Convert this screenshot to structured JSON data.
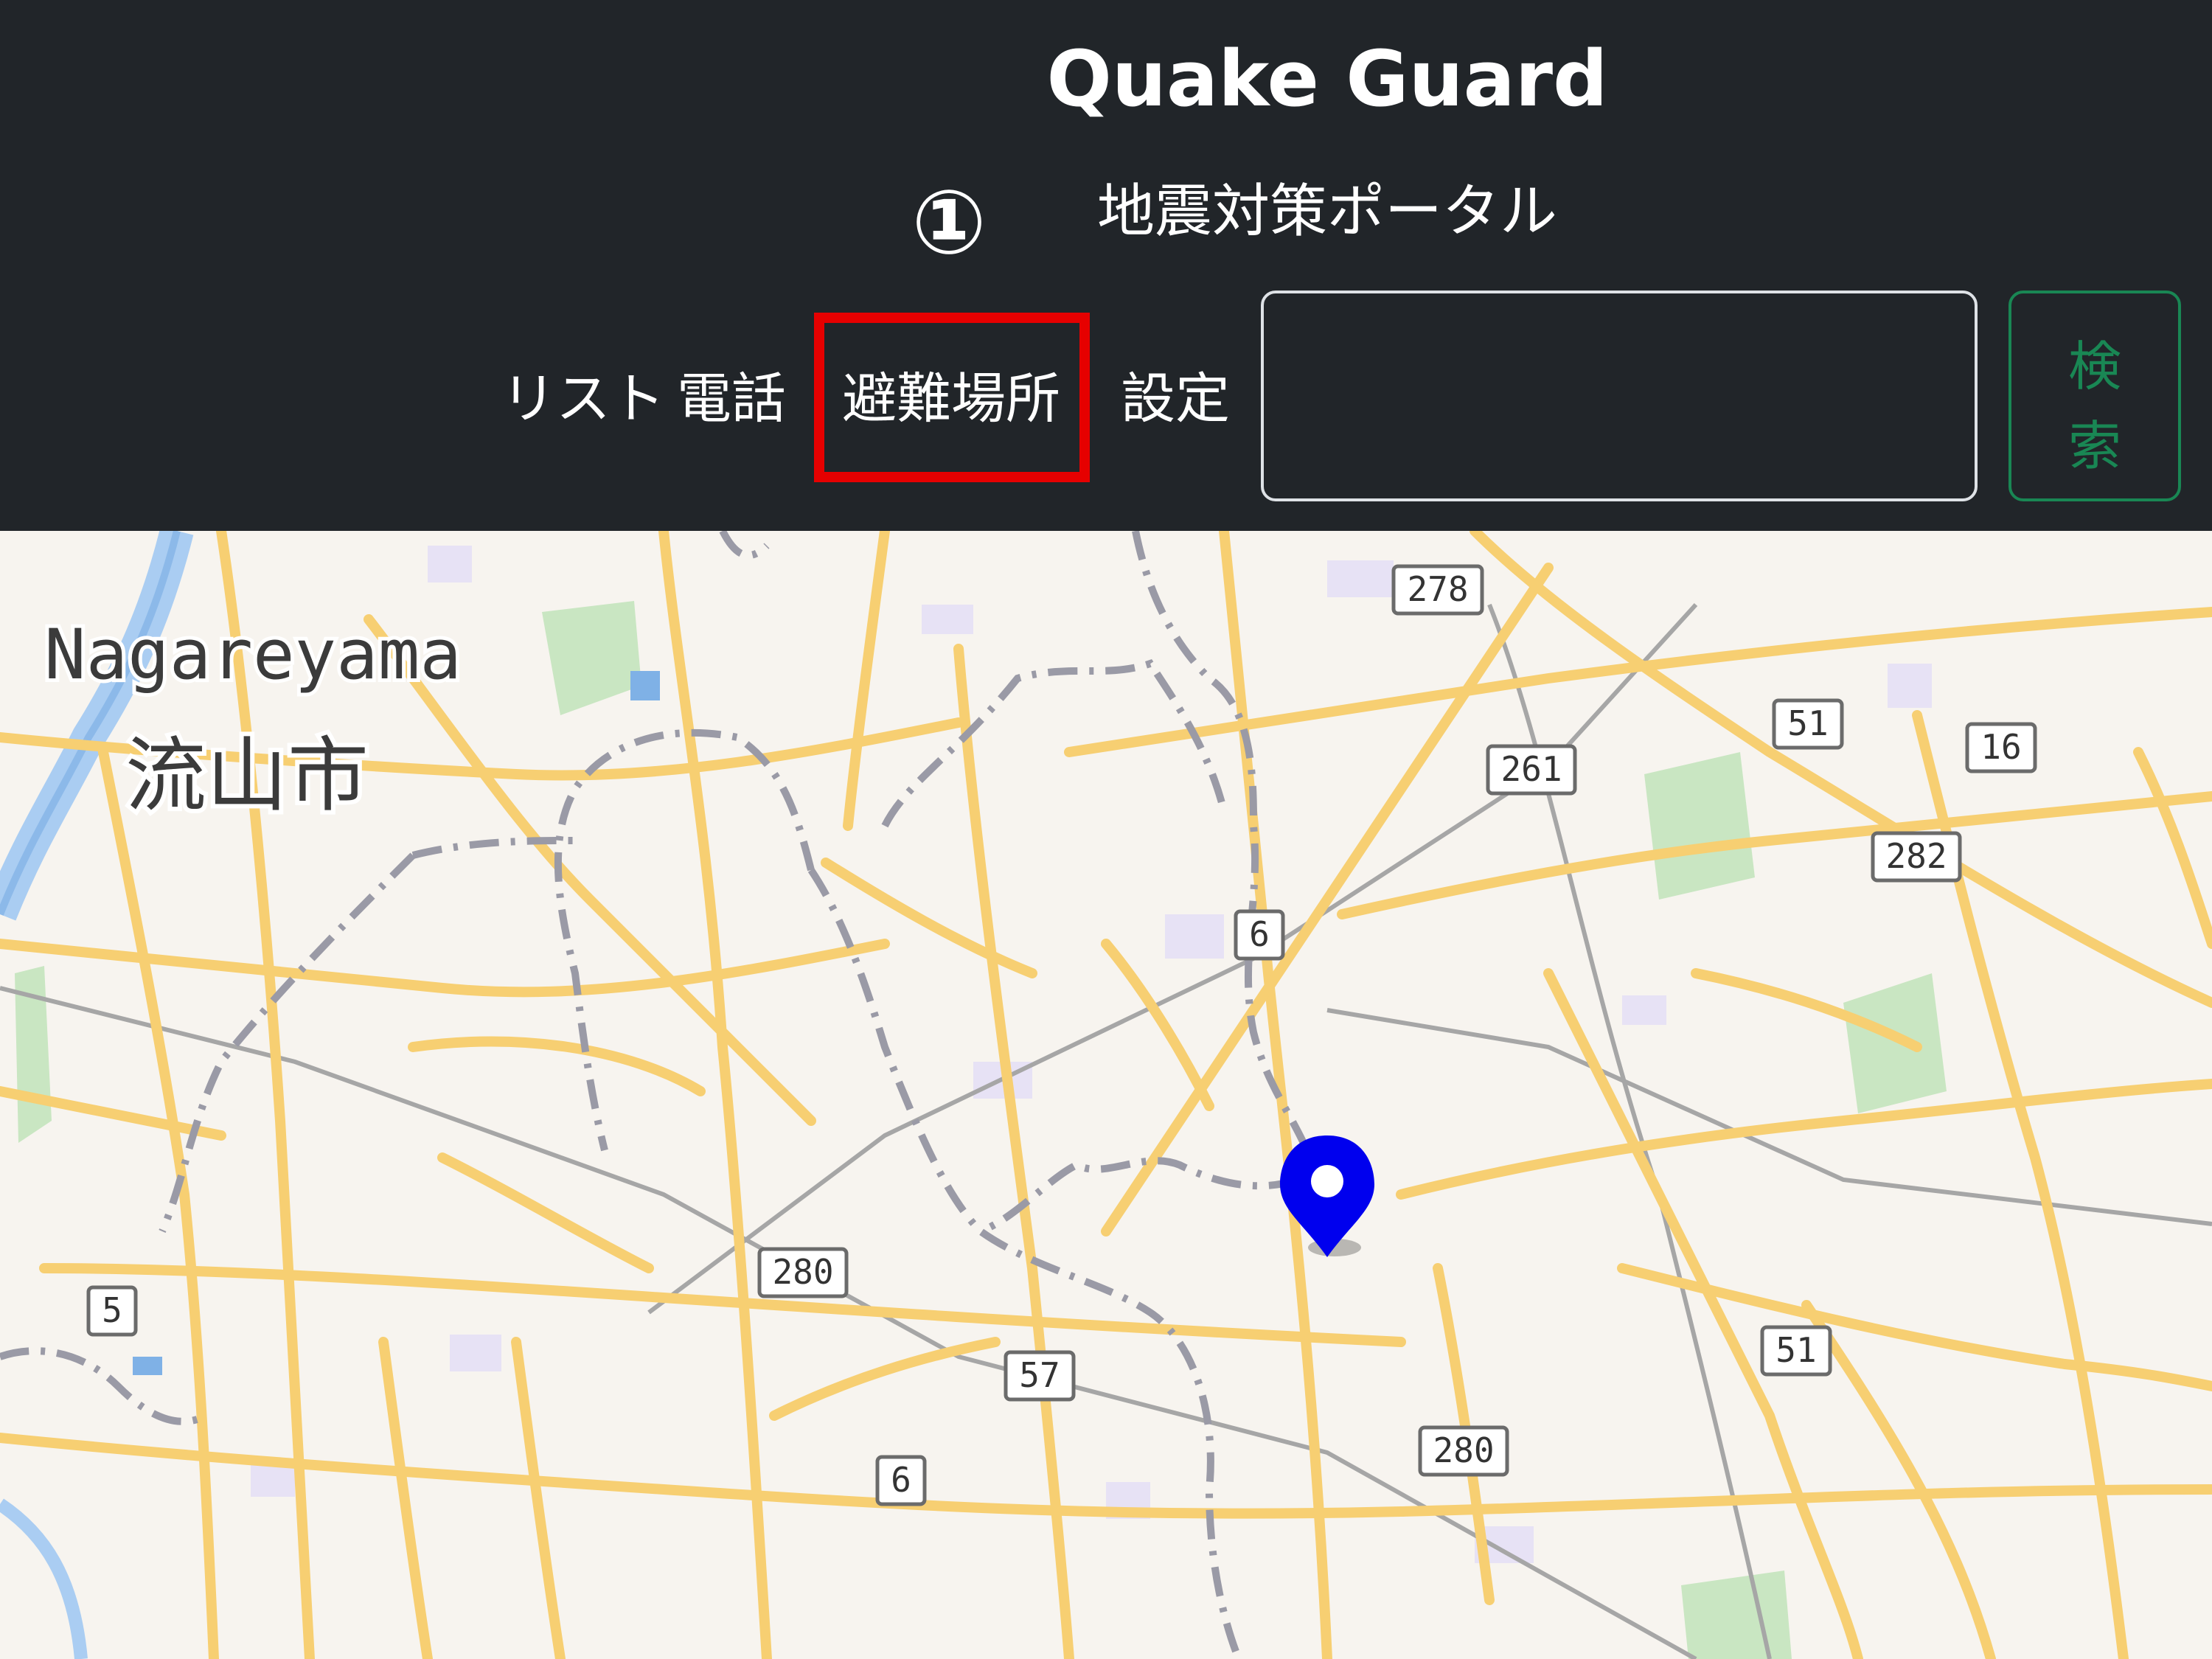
{
  "header": {
    "app_title": "Quake Guard",
    "subtitle": "地震対策ポータル",
    "step_marker": "①",
    "nav": [
      {
        "label": "リスト"
      },
      {
        "label": "電話"
      },
      {
        "label": "避難場所"
      },
      {
        "label": "設定"
      }
    ],
    "search": {
      "value": "",
      "button_label_line1": "検",
      "button_label_line2": "索"
    },
    "highlighted_item": "避難場所",
    "highlight_color": "#e60000",
    "accent_color": "#198754"
  },
  "map": {
    "place_name_en": "Nagareyama",
    "place_name_ja": "流山市",
    "route_shields": [
      "278",
      "51",
      "16",
      "261",
      "282",
      "6",
      "280",
      "57",
      "51",
      "280",
      "6",
      "5"
    ],
    "marker": "location-pin-icon",
    "marker_color": "#0000ee"
  }
}
